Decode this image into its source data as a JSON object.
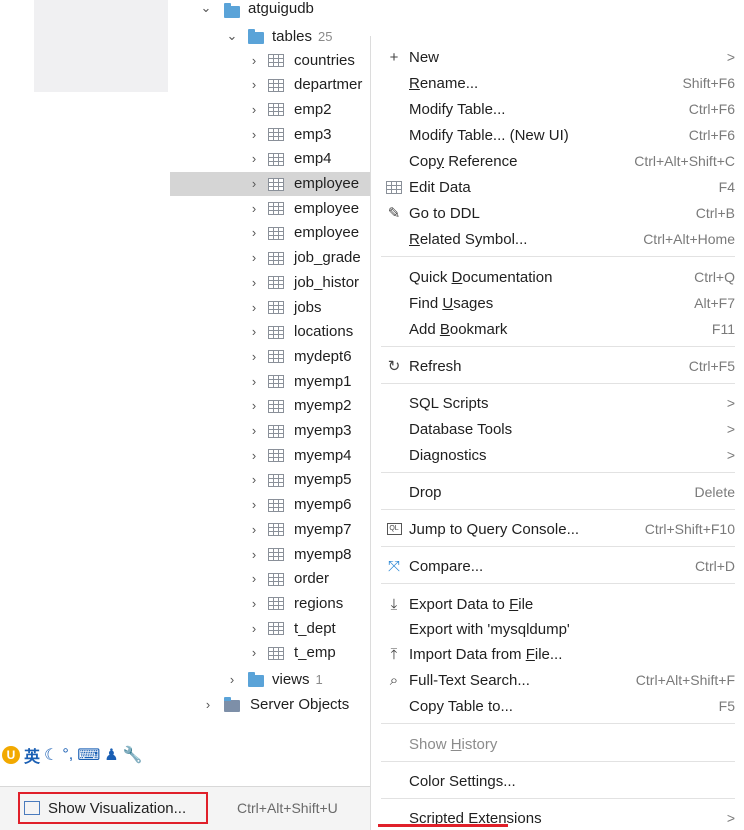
{
  "tree": {
    "db_name": "atguigudb",
    "tables_label": "tables",
    "tables_count": "25",
    "tables": [
      "countries",
      "departmer",
      "emp2",
      "emp3",
      "emp4",
      "employee",
      "employee",
      "employee",
      "job_grade",
      "job_histor",
      "jobs",
      "locations",
      "mydept6",
      "myemp1",
      "myemp2",
      "myemp3",
      "myemp4",
      "myemp5",
      "myemp6",
      "myemp7",
      "myemp8",
      "order",
      "regions",
      "t_dept",
      "t_emp"
    ],
    "views_label": "views",
    "views_count": "1",
    "server_objects_label": "Server Objects"
  },
  "menu": {
    "new": {
      "label": "New",
      "shortcut": ">"
    },
    "rename": {
      "label_pre": "",
      "label_u": "R",
      "label_post": "ename...",
      "shortcut": "Shift+F6"
    },
    "modify_table": {
      "label": "Modify Table...",
      "shortcut": "Ctrl+F6"
    },
    "modify_table_new": {
      "label": "Modify Table... (New UI)",
      "shortcut": "Ctrl+F6"
    },
    "copy_reference": {
      "label_pre": "Cop",
      "label_u": "y",
      "label_post": " Reference",
      "shortcut": "Ctrl+Alt+Shift+C"
    },
    "edit_data": {
      "label": "Edit Data",
      "shortcut": "F4"
    },
    "go_to_ddl": {
      "label": "Go to DDL",
      "shortcut": "Ctrl+B"
    },
    "related_symbol": {
      "label_pre": "",
      "label_u": "R",
      "label_post": "elated Symbol...",
      "shortcut": "Ctrl+Alt+Home"
    },
    "quick_doc": {
      "label_pre": "Quick ",
      "label_u": "D",
      "label_post": "ocumentation",
      "shortcut": "Ctrl+Q"
    },
    "find_usages": {
      "label_pre": "Find ",
      "label_u": "U",
      "label_post": "sages",
      "shortcut": "Alt+F7"
    },
    "add_bookmark": {
      "label_pre": "Add ",
      "label_u": "B",
      "label_post": "ookmark",
      "shortcut": "F11"
    },
    "refresh": {
      "label": "Refresh",
      "shortcut": "Ctrl+F5"
    },
    "sql_scripts": {
      "label": "SQL Scripts",
      "shortcut": ">"
    },
    "database_tools": {
      "label": "Database Tools",
      "shortcut": ">"
    },
    "diagnostics": {
      "label": "Diagnostics",
      "shortcut": ">"
    },
    "drop": {
      "label": "Drop",
      "shortcut": "Delete"
    },
    "jump_console": {
      "label": "Jump to Query Console...",
      "shortcut": "Ctrl+Shift+F10"
    },
    "compare": {
      "label": "Compare...",
      "shortcut": "Ctrl+D"
    },
    "export_data": {
      "label_pre": "Export Data to ",
      "label_u": "F",
      "label_post": "ile",
      "shortcut": ""
    },
    "export_mysqldump": {
      "label": "Export with 'mysqldump'",
      "shortcut": ""
    },
    "import_data": {
      "label_pre": "Import Data from ",
      "label_u": "F",
      "label_post": "ile...",
      "shortcut": ""
    },
    "full_text_search": {
      "label": "Full-Text Search...",
      "shortcut": "Ctrl+Alt+Shift+F"
    },
    "copy_table": {
      "label": "Copy Table to...",
      "shortcut": "F5"
    },
    "show_history": {
      "label_pre": "Show ",
      "label_u": "H",
      "label_post": "istory",
      "shortcut": ""
    },
    "color_settings": {
      "label": "Color Settings...",
      "shortcut": ""
    },
    "scripted_extensions": {
      "label": "Scripted Extensions",
      "shortcut": ">"
    }
  },
  "ime_bar": {
    "text": "英"
  },
  "show_visualization": {
    "label": "Show Visualization...",
    "shortcut": "Ctrl+Alt+Shift+U"
  }
}
